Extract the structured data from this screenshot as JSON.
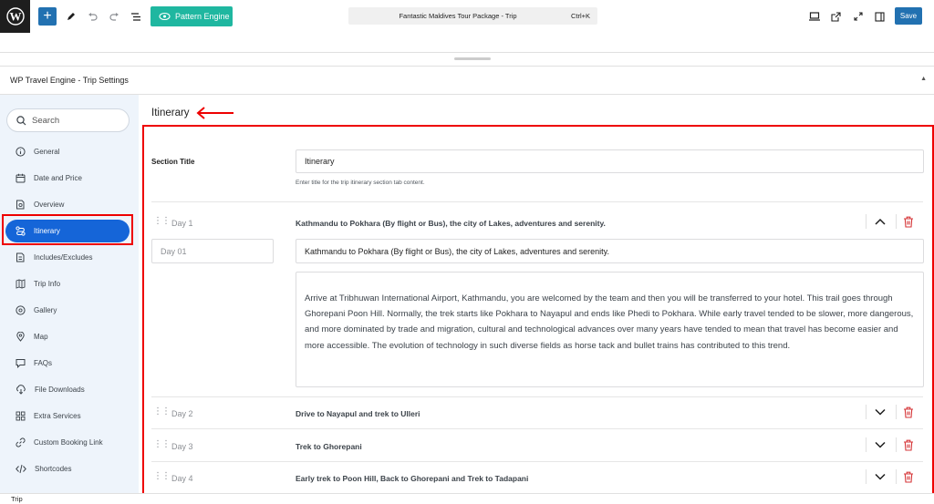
{
  "toolbar": {
    "add_label": "+",
    "pattern_label": "Pattern Engine",
    "doc_title": "Fantastic Maldives Tour Package - Trip",
    "shortcut": "Ctrl+K",
    "save_label": "Save"
  },
  "meta_box": {
    "title": "WP Travel Engine - Trip Settings"
  },
  "sidebar": {
    "search_placeholder": "Search",
    "items": [
      {
        "label": "General"
      },
      {
        "label": "Date and Price"
      },
      {
        "label": "Overview"
      },
      {
        "label": "Itinerary"
      },
      {
        "label": "Includes/Excludes"
      },
      {
        "label": "Trip Info"
      },
      {
        "label": "Gallery"
      },
      {
        "label": "Map"
      },
      {
        "label": "FAQs"
      },
      {
        "label": "File Downloads"
      },
      {
        "label": "Extra Services"
      },
      {
        "label": "Custom Booking Link"
      },
      {
        "label": "Shortcodes"
      }
    ],
    "active": "Itinerary"
  },
  "main": {
    "heading": "Itinerary",
    "section_title_label": "Section Title",
    "section_title_value": "Itinerary",
    "section_title_hint": "Enter title for the trip itinerary section tab content.",
    "days": [
      {
        "label": "Day 1",
        "title": "Kathmandu to Pokhara (By flight or Bus), the city of Lakes, adventures and serenity.",
        "expanded": true,
        "day_placeholder": "Day 01",
        "title_value": "Kathmandu to Pokhara (By flight or Bus), the city of Lakes, adventures and serenity.",
        "description": "Arrive at Tribhuwan International Airport, Kathmandu, you are welcomed by the team and then you will be transferred to your hotel. This trail goes through Ghorepani Poon Hill. Normally, the trek starts like Pokhara to Nayapul and ends like Phedi to Pokhara. While early travel tended to be slower, more dangerous, and more dominated by trade and migration, cultural and technological advances over many years have tended to mean that travel has become easier and more accessible. The evolution of technology in such diverse fields as horse tack and bullet trains has contributed to this trend."
      },
      {
        "label": "Day 2",
        "title": "Drive to Nayapul and trek to Ulleri",
        "expanded": false
      },
      {
        "label": "Day 3",
        "title": "Trek to Ghorepani",
        "expanded": false
      },
      {
        "label": "Day 4",
        "title": "Early trek to Poon Hill, Back to Ghorepani and Trek to Tadapani",
        "expanded": false
      }
    ]
  },
  "footer": {
    "breadcrumb": "Trip"
  },
  "colors": {
    "accent": "#1565d8",
    "highlight": "#ee0000",
    "pattern": "#1fb7a0",
    "delete": "#d63638"
  }
}
